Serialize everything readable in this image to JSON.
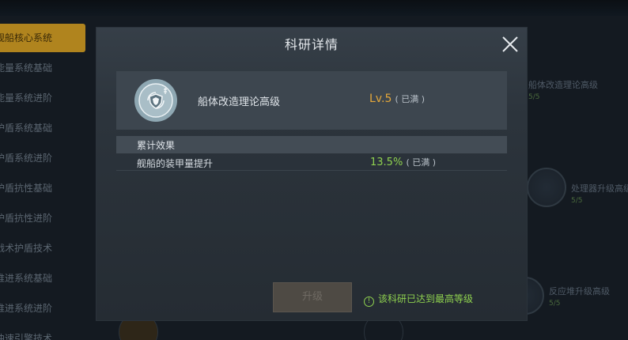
{
  "sidebar": {
    "items": [
      {
        "label": "舰船核心系统",
        "active": true
      },
      {
        "label": "能量系统基础",
        "active": false
      },
      {
        "label": "能量系统进阶",
        "active": false
      },
      {
        "label": "护盾系统基础",
        "active": false
      },
      {
        "label": "护盾系统进阶",
        "active": false
      },
      {
        "label": "护盾抗性基础",
        "active": false
      },
      {
        "label": "护盾抗性进阶",
        "active": false
      },
      {
        "label": "战术护盾技术",
        "active": false
      },
      {
        "label": "推进系统基础",
        "active": false
      },
      {
        "label": "推进系统进阶",
        "active": false
      },
      {
        "label": "曲速引擎技术",
        "active": false
      }
    ]
  },
  "tree_nodes": [
    {
      "name": "船体改造理论高级",
      "progress": "5/5"
    },
    {
      "name": "处理器升级高级",
      "progress": "5/5"
    },
    {
      "name": "反应堆升级高级",
      "progress": "5/5"
    }
  ],
  "dialog": {
    "title": "科研详情",
    "close_icon": "close-icon",
    "tech": {
      "icon": "shield-tech-icon",
      "name": "船体改造理论高级",
      "level": "Lv.5",
      "level_status": "( 已满 )"
    },
    "effects": {
      "header": "累计效果",
      "rows": [
        {
          "name": "舰船的装甲量提升",
          "value": "13.5%",
          "status": "( 已满 )"
        }
      ]
    },
    "upgrade_button": "升级",
    "max_note": "该科研已达到最高等级",
    "max_note_icon": "!"
  },
  "colors": {
    "accent_gold": "#e3a73a",
    "accent_green": "#8fd14f",
    "active_tab": "#b0841e"
  }
}
